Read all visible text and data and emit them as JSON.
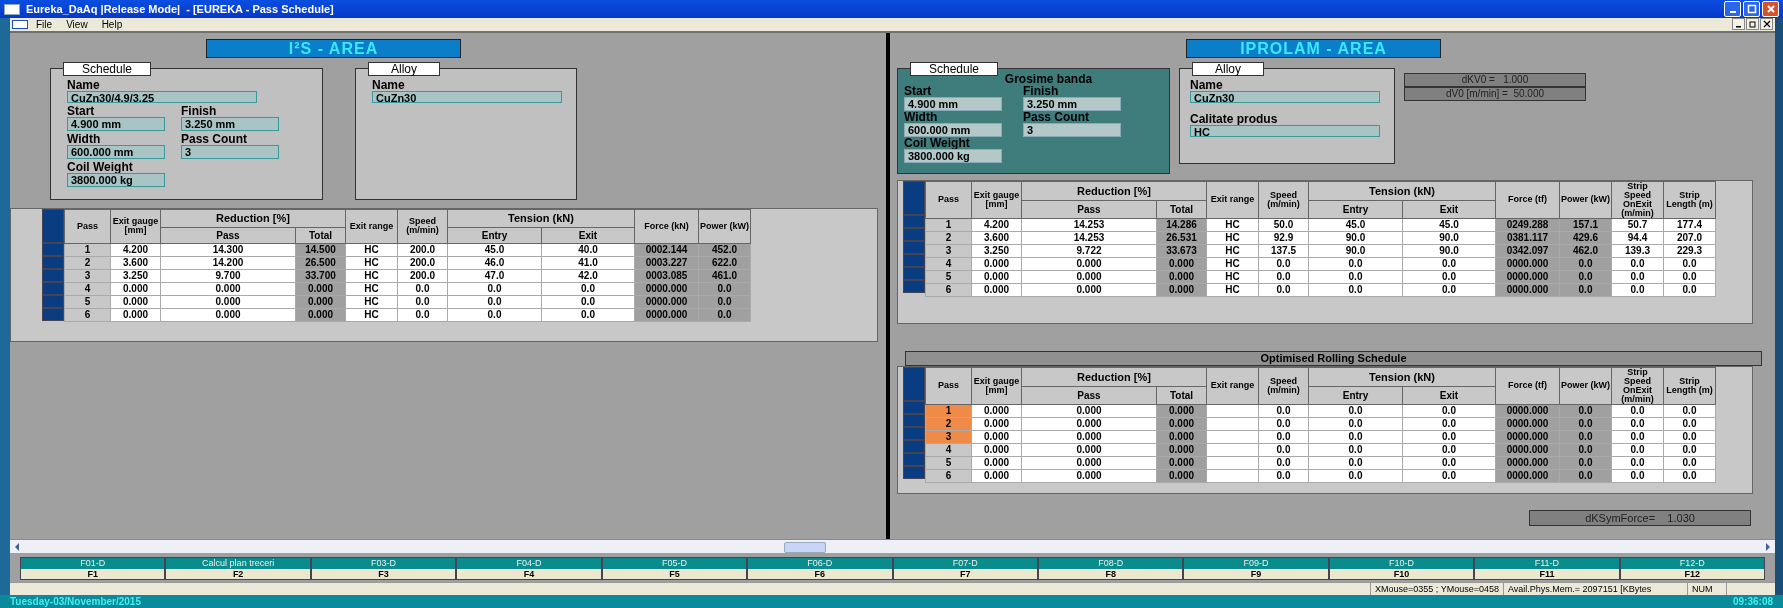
{
  "window": {
    "title": "Eureka_DaAq |Release Mode|  - [EUREKA - Pass Schedule]"
  },
  "menu": [
    "File",
    "View",
    "Help"
  ],
  "left": {
    "area_title": "I²S - AREA",
    "schedule": {
      "legend": "Schedule",
      "fields": [
        {
          "label": "Name",
          "value": "CuZn30/4.9/3.25",
          "kind": "wide"
        },
        {
          "label": "Start",
          "value": "4.900 mm",
          "kind": "half"
        },
        {
          "label": "Finish",
          "value": "3.250 mm",
          "kind": "half"
        },
        {
          "label": "Width",
          "value": "600.000 mm",
          "kind": "half"
        },
        {
          "label": "Pass Count",
          "value": "3",
          "kind": "half"
        },
        {
          "label": "Coil Weight",
          "value": "3800.000 kg",
          "kind": "half"
        }
      ]
    },
    "alloy": {
      "legend": "Alloy",
      "fields": [
        {
          "label": "Name",
          "value": "CuZn30",
          "kind": "wide"
        }
      ]
    },
    "table": {
      "columns": [
        {
          "label": "Pass",
          "kind": "key"
        },
        {
          "label": "Exit gauge [mm]",
          "kind": "value"
        },
        {
          "label": "Reduction [%]",
          "colspan": 2,
          "sub": [
            {
              "label": "Pass",
              "kind": "value"
            },
            {
              "label": "Total",
              "kind": "shaded"
            }
          ]
        },
        {
          "label": "Exit range",
          "kind": "value"
        },
        {
          "label": "Speed (m/min)",
          "kind": "value"
        },
        {
          "label": "Tension (kN)",
          "colspan": 2,
          "sub": [
            {
              "label": "Entry",
              "kind": "value"
            },
            {
              "label": "Exit",
              "kind": "value"
            }
          ]
        },
        {
          "label": "Force (kN)",
          "kind": "shaded"
        },
        {
          "label": "Power (kW)",
          "kind": "shaded"
        }
      ],
      "rows": [
        {
          "cells": [
            "1",
            "4.200",
            "14.300",
            "14.500",
            "HC",
            "200.0",
            "45.0",
            "40.0",
            "0002.144",
            "452.0"
          ]
        },
        {
          "cells": [
            "2",
            "3.600",
            "14.200",
            "26.500",
            "HC",
            "200.0",
            "46.0",
            "41.0",
            "0003.227",
            "622.0"
          ]
        },
        {
          "cells": [
            "3",
            "3.250",
            "9.700",
            "33.700",
            "HC",
            "200.0",
            "47.0",
            "42.0",
            "0003.085",
            "461.0"
          ]
        },
        {
          "cells": [
            "4",
            "0.000",
            "0.000",
            "0.000",
            "HC",
            "0.0",
            "0.0",
            "0.0",
            "0000.000",
            "0.0"
          ]
        },
        {
          "cells": [
            "5",
            "0.000",
            "0.000",
            "0.000",
            "HC",
            "0.0",
            "0.0",
            "0.0",
            "0000.000",
            "0.0"
          ]
        },
        {
          "cells": [
            "6",
            "0.000",
            "0.000",
            "0.000",
            "HC",
            "0.0",
            "0.0",
            "0.0",
            "0000.000",
            "0.0"
          ]
        }
      ]
    }
  },
  "right": {
    "area_title": "IPROLAM - AREA",
    "schedule": {
      "legend": "Schedule",
      "heading": "Grosime banda",
      "fields": [
        {
          "label": "Start",
          "value": "4.900 mm",
          "kind": "half"
        },
        {
          "label": "Finish",
          "value": "3.250 mm",
          "kind": "half"
        },
        {
          "label": "Width",
          "value": "600.000 mm",
          "kind": "half"
        },
        {
          "label": "Pass Count",
          "value": "3",
          "kind": "half"
        },
        {
          "label": "Coil Weight",
          "value": "3800.000 kg",
          "kind": "half"
        }
      ]
    },
    "alloy": {
      "legend": "Alloy",
      "fields": [
        {
          "label": "Name",
          "value": "CuZn30",
          "kind": "wide"
        },
        {
          "label": "Calitate produs",
          "value": "HC",
          "kind": "wide"
        }
      ]
    },
    "readouts": [
      "dKV0 =   1.000",
      "dV0 [m/min] =  50.000"
    ],
    "table": {
      "columns": [
        {
          "label": "Pass",
          "kind": "key"
        },
        {
          "label": "Exit gauge [mm]",
          "kind": "value"
        },
        {
          "label": "Reduction [%]",
          "colspan": 2,
          "sub": [
            {
              "label": "Pass",
              "kind": "value"
            },
            {
              "label": "Total",
              "kind": "shaded"
            }
          ]
        },
        {
          "label": "Exit range",
          "kind": "value"
        },
        {
          "label": "Speed (m/min)",
          "kind": "value"
        },
        {
          "label": "Tension (kN)",
          "colspan": 2,
          "sub": [
            {
              "label": "Entry",
              "kind": "value"
            },
            {
              "label": "Exit",
              "kind": "value"
            }
          ]
        },
        {
          "label": "Force (tf)",
          "kind": "shaded"
        },
        {
          "label": "Power (kW)",
          "kind": "shaded"
        },
        {
          "label": "Strip Speed OnExit (m/min)",
          "kind": "value"
        },
        {
          "label": "Strip Length (m)",
          "kind": "value"
        }
      ],
      "rows": [
        {
          "cells": [
            "1",
            "4.200",
            "14.253",
            "14.286",
            "HC",
            "50.0",
            "45.0",
            "45.0",
            "0249.288",
            "157.1",
            "50.7",
            "177.4"
          ]
        },
        {
          "cells": [
            "2",
            "3.600",
            "14.253",
            "26.531",
            "HC",
            "92.9",
            "90.0",
            "90.0",
            "0381.117",
            "429.6",
            "94.4",
            "207.0"
          ]
        },
        {
          "cells": [
            "3",
            "3.250",
            "9.722",
            "33.673",
            "HC",
            "137.5",
            "90.0",
            "90.0",
            "0342.097",
            "462.0",
            "139.3",
            "229.3"
          ]
        },
        {
          "cells": [
            "4",
            "0.000",
            "0.000",
            "0.000",
            "HC",
            "0.0",
            "0.0",
            "0.0",
            "0000.000",
            "0.0",
            "0.0",
            "0.0"
          ]
        },
        {
          "cells": [
            "5",
            "0.000",
            "0.000",
            "0.000",
            "HC",
            "0.0",
            "0.0",
            "0.0",
            "0000.000",
            "0.0",
            "0.0",
            "0.0"
          ]
        },
        {
          "cells": [
            "6",
            "0.000",
            "0.000",
            "0.000",
            "HC",
            "0.0",
            "0.0",
            "0.0",
            "0000.000",
            "0.0",
            "0.0",
            "0.0"
          ]
        }
      ]
    },
    "optimised": {
      "title": "Optimised Rolling Schedule",
      "table": {
        "columns": [
          {
            "label": "Pass",
            "kind": "key"
          },
          {
            "label": "Exit gauge [mm]",
            "kind": "value"
          },
          {
            "label": "Reduction [%]",
            "colspan": 2,
            "sub": [
              {
                "label": "Pass",
                "kind": "value"
              },
              {
                "label": "Total",
                "kind": "shaded"
              }
            ]
          },
          {
            "label": "Exit range",
            "kind": "value"
          },
          {
            "label": "Speed (m/min)",
            "kind": "value"
          },
          {
            "label": "Tension (kN)",
            "colspan": 2,
            "sub": [
              {
                "label": "Entry",
                "kind": "value"
              },
              {
                "label": "Exit",
                "kind": "value"
              }
            ]
          },
          {
            "label": "Force (tf)",
            "kind": "shaded"
          },
          {
            "label": "Power (kW)",
            "kind": "shaded"
          },
          {
            "label": "Strip Speed OnExit (m/min)",
            "kind": "value"
          },
          {
            "label": "Strip Length (m)",
            "kind": "value"
          }
        ],
        "rows": [
          {
            "flagged": true,
            "cells": [
              "1",
              "0.000",
              "0.000",
              "0.000",
              null,
              "0.0",
              "0.0",
              "0.0",
              "0000.000",
              "0.0",
              "0.0",
              "0.0"
            ]
          },
          {
            "flagged": true,
            "cells": [
              "2",
              "0.000",
              "0.000",
              "0.000",
              null,
              "0.0",
              "0.0",
              "0.0",
              "0000.000",
              "0.0",
              "0.0",
              "0.0"
            ]
          },
          {
            "flagged": true,
            "cells": [
              "3",
              "0.000",
              "0.000",
              "0.000",
              null,
              "0.0",
              "0.0",
              "0.0",
              "0000.000",
              "0.0",
              "0.0",
              "0.0"
            ]
          },
          {
            "flagged": false,
            "cells": [
              "4",
              "0.000",
              "0.000",
              "0.000",
              null,
              "0.0",
              "0.0",
              "0.0",
              "0000.000",
              "0.0",
              "0.0",
              "0.0"
            ]
          },
          {
            "flagged": false,
            "cells": [
              "5",
              "0.000",
              "0.000",
              "0.000",
              null,
              "0.0",
              "0.0",
              "0.0",
              "0000.000",
              "0.0",
              "0.0",
              "0.0"
            ]
          },
          {
            "flagged": false,
            "cells": [
              "6",
              "0.000",
              "0.000",
              "0.000",
              null,
              "0.0",
              "0.0",
              "0.0",
              "0000.000",
              "0.0",
              "0.0",
              "0.0"
            ]
          }
        ]
      }
    },
    "sym_force": "dKSymForce=    1.030"
  },
  "function_keys": [
    {
      "caption": "F01-D",
      "key": "F1"
    },
    {
      "caption": "Calcul plan treceri",
      "key": "F2"
    },
    {
      "caption": "F03-D",
      "key": "F3"
    },
    {
      "caption": "F04-D",
      "key": "F4"
    },
    {
      "caption": "F05-D",
      "key": "F5"
    },
    {
      "caption": "F06-D",
      "key": "F6"
    },
    {
      "caption": "F07-D",
      "key": "F7"
    },
    {
      "caption": "F08-D",
      "key": "F8"
    },
    {
      "caption": "F09-D",
      "key": "F9"
    },
    {
      "caption": "F10-D",
      "key": "F10"
    },
    {
      "caption": "F11-D",
      "key": "F11"
    },
    {
      "caption": "F12-D",
      "key": "F12"
    }
  ],
  "status_bar": {
    "mouse": "XMouse=0355 ; YMouse=0458",
    "memory": "Avail.Phys.Mem.= 2097151 [KBytes",
    "num": "NUM"
  },
  "footer": {
    "date": "Tuesday-03/November/2015",
    "time": "09:36:08"
  }
}
